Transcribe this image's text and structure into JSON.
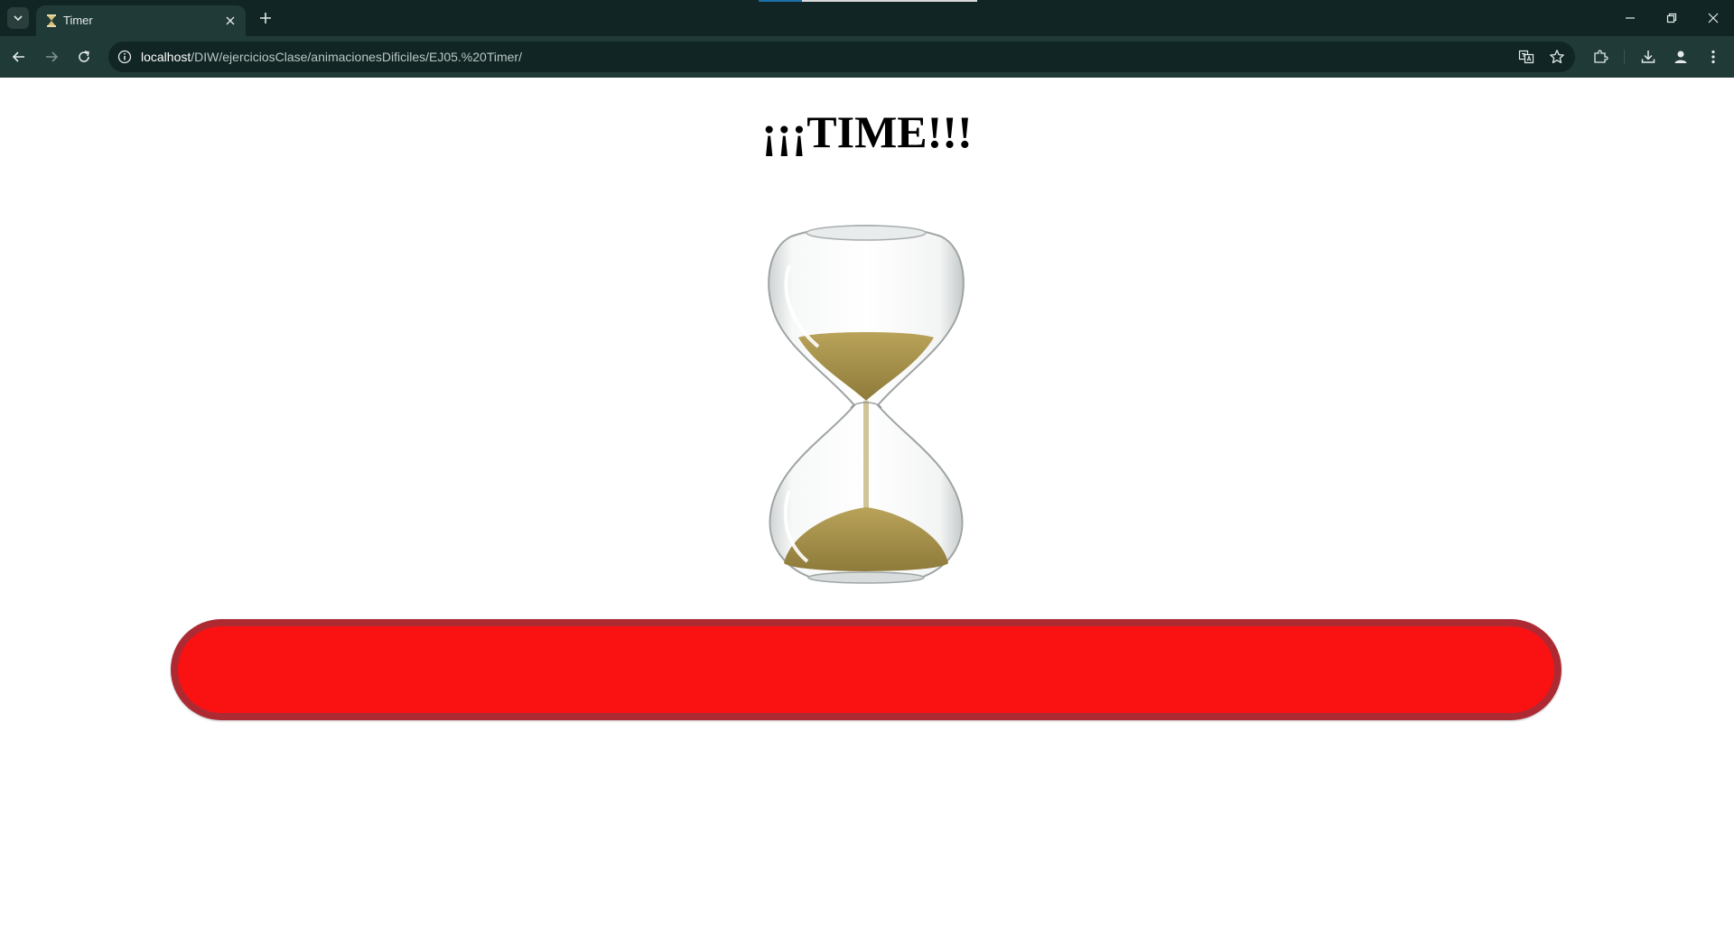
{
  "browser": {
    "tab_title": "Timer",
    "favicon": "hourglass-icon",
    "url_host": "localhost",
    "url_path": "/DIW/ejerciciosClase/animacionesDificiles/EJ05.%20Timer/"
  },
  "page": {
    "title": "¡¡¡TIME!!!",
    "image": "hourglass",
    "progress": {
      "value": 1.0,
      "fill_color": "#fa1213",
      "track_color": "#ad2a33"
    }
  },
  "colors": {
    "chrome_dark": "#112624",
    "chrome_toolbar": "#203a37",
    "sand": "#b09a52"
  }
}
